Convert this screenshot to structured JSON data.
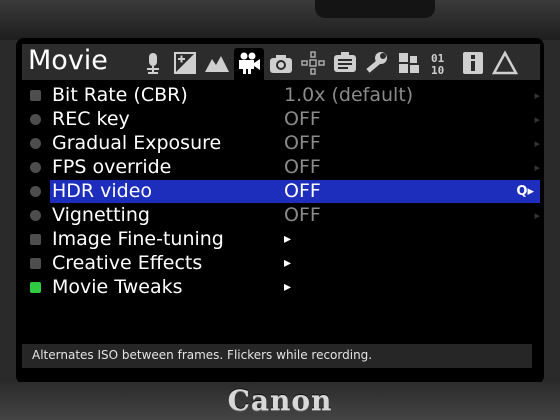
{
  "brand": "Canon",
  "tab_bar": {
    "title": "Movie",
    "tabs": [
      {
        "icon": "microphone-icon"
      },
      {
        "icon": "exposure-icon"
      },
      {
        "icon": "overlay-icon"
      },
      {
        "icon": "movie-camera-icon",
        "active": true
      },
      {
        "icon": "camera-icon"
      },
      {
        "icon": "focus-icon"
      },
      {
        "icon": "display-icon"
      },
      {
        "icon": "wrench-icon"
      },
      {
        "icon": "modules-icon"
      },
      {
        "icon": "debug-binary-icon"
      },
      {
        "icon": "info-icon"
      },
      {
        "icon": "warning-icon"
      }
    ]
  },
  "menu": {
    "items": [
      {
        "label": "Bit Rate (CBR)",
        "value": "1.0x (default)"
      },
      {
        "label": "REC key",
        "value": "OFF"
      },
      {
        "label": "Gradual Exposure",
        "value": "OFF"
      },
      {
        "label": "FPS override",
        "value": "OFF"
      },
      {
        "label": "HDR video",
        "value": "OFF",
        "selected": true,
        "badge": "Q▸"
      },
      {
        "label": "Vignetting",
        "value": "OFF"
      },
      {
        "label": "Image Fine-tuning",
        "value": "▸"
      },
      {
        "label": "Creative Effects",
        "value": "▸"
      },
      {
        "label": "Movie Tweaks",
        "value": "▸",
        "active": true
      }
    ]
  },
  "help_text": "Alternates ISO between frames. Flickers while recording.",
  "colors": {
    "highlight": "#1c2ebb",
    "active_indicator": "#2ecc40",
    "inactive_indicator": "#4d4d4d",
    "value_text": "#8a8a8a"
  }
}
